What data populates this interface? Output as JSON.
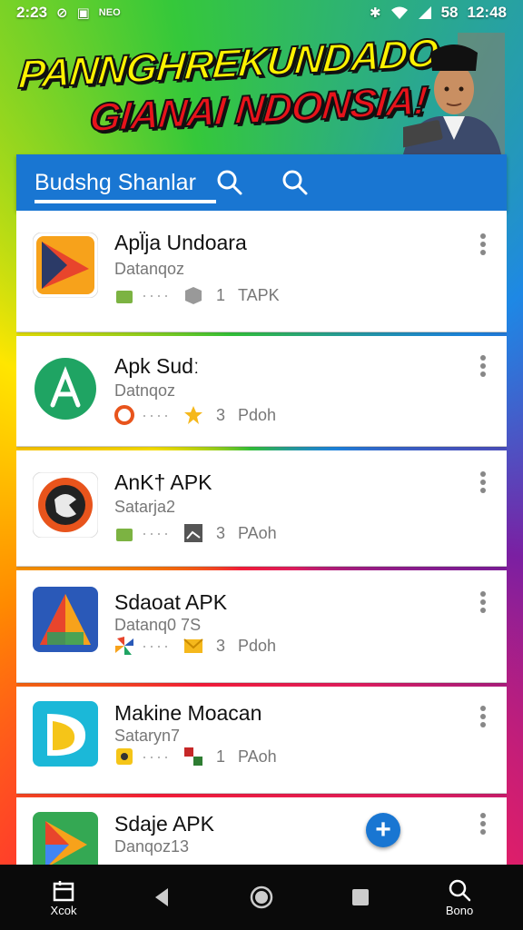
{
  "status_bar": {
    "time_left": "2:23",
    "indicator": "NEO",
    "battery": "58",
    "time_right": "12:48"
  },
  "banner": {
    "line1": "PANNGHREKUNDADO",
    "line2": "GIANAI NDONSIA!"
  },
  "app_bar": {
    "title": "Budshg Shanlar",
    "icons": [
      "search-icon",
      "search-icon"
    ]
  },
  "apps": [
    {
      "name": "Apl̈ja Undoara",
      "developer": "Datanqoz",
      "count": "1",
      "tag": "TAPK",
      "icon": "colorful-triangle-icon",
      "color": "#e8452c"
    },
    {
      "name": "Apk Sudː",
      "developer": "Datnqoz",
      "count": "3",
      "tag": "Pdoh",
      "icon": "green-a-icon",
      "color": "#1fa463"
    },
    {
      "name": "AnK† APK",
      "developer": "Satarja2",
      "count": "3",
      "tag": "PAoh",
      "icon": "orange-ring-icon",
      "color": "#e8541c"
    },
    {
      "name": "Sdaoat APK",
      "developer": "Datanq0 7S",
      "count": "3",
      "tag": "Pdoh",
      "icon": "blue-a-icon",
      "color": "#2a59b8"
    },
    {
      "name": "Makine Moacan",
      "developer": "Sataryn7",
      "count": "1",
      "tag": "PAoh",
      "icon": "cyan-d-icon",
      "color": "#1bb8d8"
    },
    {
      "name": "Sdaje APK",
      "developer": "Danqoz13",
      "count": "",
      "tag": "",
      "icon": "play-triangle-icon",
      "color": "#34a853"
    }
  ],
  "fab": {
    "label": "+"
  },
  "nav": [
    {
      "label": "Xcok",
      "icon": "store-icon"
    },
    {
      "label": "",
      "icon": "back-icon"
    },
    {
      "label": "",
      "icon": "home-icon"
    },
    {
      "label": "",
      "icon": "recents-icon"
    },
    {
      "label": "Bono",
      "icon": "search-icon"
    }
  ]
}
